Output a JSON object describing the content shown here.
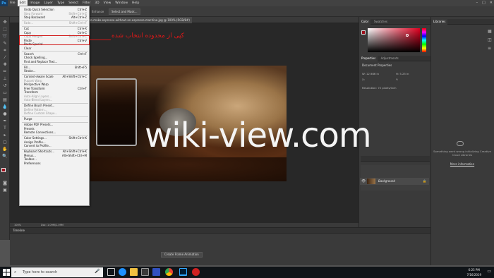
{
  "menubar": {
    "items": [
      "File",
      "Edit",
      "Image",
      "Layer",
      "Type",
      "Select",
      "Filter",
      "3D",
      "View",
      "Window",
      "Help"
    ],
    "active": "Edit"
  },
  "optbar": {
    "refine_label": "Select and Mask...",
    "enhance_label": "Enhance"
  },
  "document": {
    "tab_title": "how-to-make-espresso-without-an-espresso-machine.jpg @ 100% (RGB/8#)"
  },
  "status": {
    "zoom": "100%",
    "doc_size": "Doc: 1.09M/1.09M"
  },
  "edit_menu": {
    "items": [
      {
        "label": "Undo Quick Selection",
        "shortcut": "Ctrl+Z",
        "disabled": false
      },
      {
        "label": "Step Forward",
        "shortcut": "Shift+Ctrl+Z",
        "disabled": true
      },
      {
        "label": "Step Backward",
        "shortcut": "Alt+Ctrl+Z",
        "disabled": false
      },
      {
        "sep": true
      },
      {
        "label": "Fade...",
        "shortcut": "Shift+Ctrl+F",
        "disabled": true
      },
      {
        "sep": true
      },
      {
        "label": "Cut",
        "shortcut": "Ctrl+X",
        "disabled": false
      },
      {
        "label": "Copy",
        "shortcut": "Ctrl+C",
        "disabled": false
      },
      {
        "label": "Copy Merged",
        "shortcut": "Shift+Ctrl+C",
        "disabled": true
      },
      {
        "label": "Paste",
        "shortcut": "Ctrl+V",
        "disabled": false
      },
      {
        "label": "Paste Special",
        "shortcut": "",
        "disabled": false
      },
      {
        "label": "Clear",
        "shortcut": "",
        "disabled": false
      },
      {
        "sep": true
      },
      {
        "label": "Search",
        "shortcut": "Ctrl+F",
        "disabled": false
      },
      {
        "label": "Check Spelling...",
        "shortcut": "",
        "disabled": false
      },
      {
        "label": "Find and Replace Text...",
        "shortcut": "",
        "disabled": false
      },
      {
        "sep": true
      },
      {
        "label": "Fill...",
        "shortcut": "Shift+F5",
        "disabled": false
      },
      {
        "label": "Stroke...",
        "shortcut": "",
        "disabled": false
      },
      {
        "sep": true
      },
      {
        "label": "Content-Aware Scale",
        "shortcut": "Alt+Shift+Ctrl+C",
        "disabled": false
      },
      {
        "label": "Puppet Warp",
        "shortcut": "",
        "disabled": true
      },
      {
        "label": "Perspective Warp",
        "shortcut": "",
        "disabled": false
      },
      {
        "label": "Free Transform",
        "shortcut": "Ctrl+T",
        "disabled": false
      },
      {
        "label": "Transform",
        "shortcut": "",
        "disabled": false
      },
      {
        "label": "Auto-Align Layers...",
        "shortcut": "",
        "disabled": true
      },
      {
        "label": "Auto-Blend Layers...",
        "shortcut": "",
        "disabled": true
      },
      {
        "sep": true
      },
      {
        "label": "Define Brush Preset...",
        "shortcut": "",
        "disabled": false
      },
      {
        "label": "Define Pattern...",
        "shortcut": "",
        "disabled": true
      },
      {
        "label": "Define Custom Shape...",
        "shortcut": "",
        "disabled": true
      },
      {
        "sep": true
      },
      {
        "label": "Purge",
        "shortcut": "",
        "disabled": false
      },
      {
        "sep": true
      },
      {
        "label": "Adobe PDF Presets...",
        "shortcut": "",
        "disabled": false
      },
      {
        "label": "Presets",
        "shortcut": "",
        "disabled": false
      },
      {
        "label": "Remote Connections...",
        "shortcut": "",
        "disabled": false
      },
      {
        "sep": true
      },
      {
        "label": "Color Settings...",
        "shortcut": "Shift+Ctrl+K",
        "disabled": false
      },
      {
        "label": "Assign Profile...",
        "shortcut": "",
        "disabled": false
      },
      {
        "label": "Convert to Profile...",
        "shortcut": "",
        "disabled": false
      },
      {
        "sep": true
      },
      {
        "label": "Keyboard Shortcuts...",
        "shortcut": "Alt+Shift+Ctrl+K",
        "disabled": false
      },
      {
        "label": "Menus...",
        "shortcut": "Alt+Shift+Ctrl+M",
        "disabled": false
      },
      {
        "label": "Toolbar...",
        "shortcut": "",
        "disabled": false
      },
      {
        "label": "Preferences",
        "shortcut": "",
        "disabled": false
      }
    ]
  },
  "annotation": "کپی از محدوده انتخاب شده",
  "watermark": "wiki-view.com",
  "panels": {
    "color_tabs": [
      "Color",
      "Swatches"
    ],
    "props_tabs": [
      "Properties",
      "Adjustments"
    ],
    "props_title": "Document Properties",
    "props_w": "W: 12.986 in",
    "props_h": "H: 5.25 in",
    "props_x": "X:",
    "props_y": "Y:",
    "props_res": "Resolution: 72 pixels/inch",
    "libraries_tab": "Libraries",
    "libraries_msg": "Something went wrong initializing Creative Cloud Libraries",
    "libraries_link": "More information",
    "layer_name": "Background",
    "fg_color": "#a0101c"
  },
  "timeline": {
    "title": "Timeline",
    "create_label": "Create Frame Animation"
  },
  "taskbar": {
    "search_placeholder": "Type here to search",
    "time": "6:25 PM",
    "date": "7/16/2019"
  }
}
